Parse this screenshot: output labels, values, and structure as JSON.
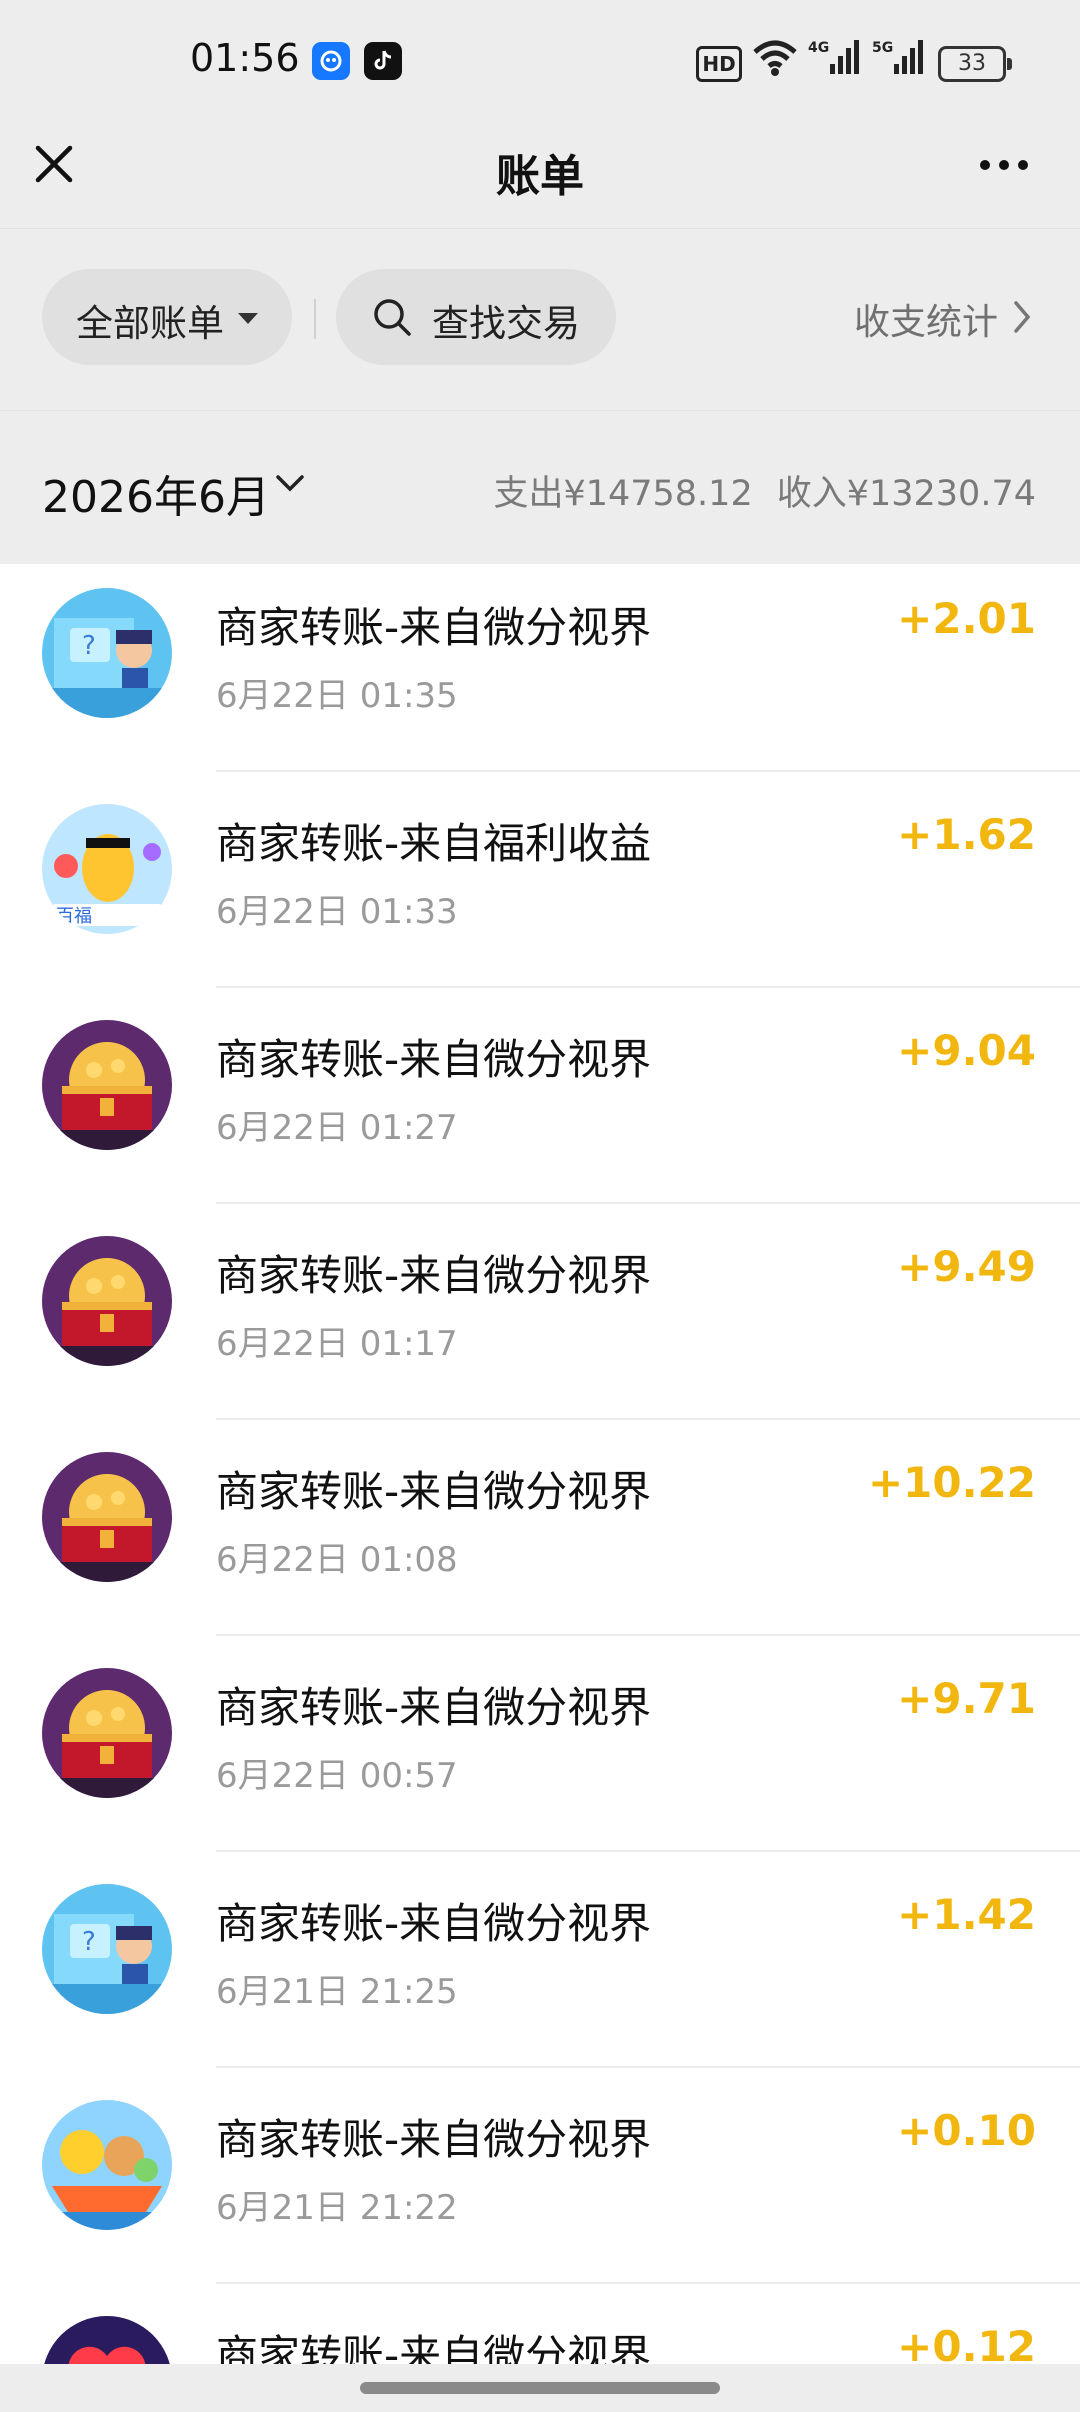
{
  "status_bar": {
    "time": "01:56",
    "battery": "33"
  },
  "header": {
    "title": "账单"
  },
  "filters": {
    "all_bills_label": "全部账单",
    "search_label": "查找交易",
    "stats_label": "收支统计"
  },
  "month_section": {
    "month": "2026年6月",
    "expense": "支出¥14758.12",
    "income": "收入¥13230.74"
  },
  "colors": {
    "amount": "#f2b70f",
    "page_bg": "#ededed"
  },
  "transactions": [
    {
      "title": "商家转账-来自微分视界",
      "time": "6月22日 01:35",
      "amount": "+2.01",
      "avatar": "game-character-avatar"
    },
    {
      "title": "商家转账-来自福利收益",
      "time": "6月22日 01:33",
      "amount": "+1.62",
      "avatar": "cartoon-duck-avatar"
    },
    {
      "title": "商家转账-来自微分视界",
      "time": "6月22日 01:27",
      "amount": "+9.04",
      "avatar": "treasure-chest-avatar"
    },
    {
      "title": "商家转账-来自微分视界",
      "time": "6月22日 01:17",
      "amount": "+9.49",
      "avatar": "treasure-chest-avatar"
    },
    {
      "title": "商家转账-来自微分视界",
      "time": "6月22日 01:08",
      "amount": "+10.22",
      "avatar": "treasure-chest-avatar"
    },
    {
      "title": "商家转账-来自微分视界",
      "time": "6月22日 00:57",
      "amount": "+9.71",
      "avatar": "treasure-chest-avatar"
    },
    {
      "title": "商家转账-来自微分视界",
      "time": "6月21日 21:25",
      "amount": "+1.42",
      "avatar": "game-character-avatar"
    },
    {
      "title": "商家转账-来自微分视界",
      "time": "6月21日 21:22",
      "amount": "+0.10",
      "avatar": "duck-boat-avatar"
    },
    {
      "title": "商家转账-来自微分视界",
      "time": "",
      "amount": "+0.12",
      "avatar": "heart-avatar"
    }
  ]
}
